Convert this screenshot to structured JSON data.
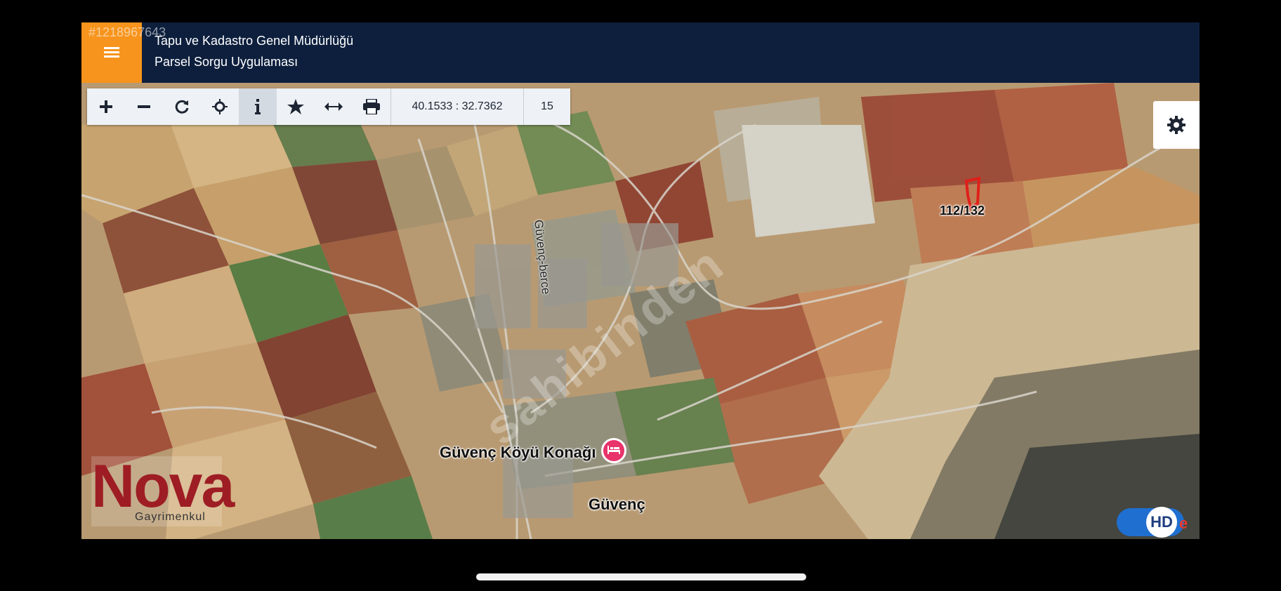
{
  "header": {
    "listing_id": "#1218967643",
    "title": "Tapu ve Kadastro Genel Müdürlüğü",
    "subtitle": "Parsel Sorgu Uygulaması",
    "menu_icon": "menu-icon",
    "accent_color": "#f7941d",
    "background_color": "#0d1f3d"
  },
  "toolbar": {
    "tools": [
      {
        "name": "zoom-in",
        "icon": "plus-icon"
      },
      {
        "name": "zoom-out",
        "icon": "minus-icon"
      },
      {
        "name": "refresh",
        "icon": "refresh-icon"
      },
      {
        "name": "locate",
        "icon": "crosshair-icon"
      },
      {
        "name": "info",
        "icon": "info-icon",
        "active": true
      },
      {
        "name": "favorite",
        "icon": "star-icon"
      },
      {
        "name": "measure",
        "icon": "arrows-horizontal-icon"
      },
      {
        "name": "print",
        "icon": "print-icon"
      }
    ],
    "coordinates": "40.1533 : 32.7362",
    "zoom_level": "15"
  },
  "settings": {
    "icon": "gear-icon"
  },
  "map": {
    "parcel_label": "112/132",
    "road_label": "Güvenç-berce",
    "poi_label": "Güvenç Köyü Konağı",
    "poi_icon": "bed-icon",
    "poi_color": "#e8336b",
    "town_label": "Güvenç"
  },
  "logo": {
    "brand": "Nova",
    "subtitle": "Gayrimenkul"
  },
  "hd_toggle": {
    "label": "HD",
    "badge": "e",
    "on": true,
    "color": "#1f6fd0"
  }
}
